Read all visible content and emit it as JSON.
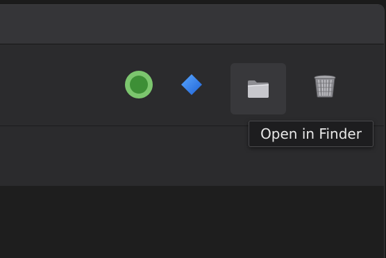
{
  "toolbar": {
    "status_icon": "status-green-dot-icon",
    "diamond_icon": "blue-diamond-icon",
    "finder_icon": "folder-icon",
    "trash_icon": "trash-icon"
  },
  "tooltip": {
    "text": "Open in Finder"
  },
  "colors": {
    "status_green_outer": "#7cc66e",
    "status_green_inner": "#3d8f36",
    "diamond_blue": "#2f80ed",
    "window_bg": "#2b2b2d",
    "titlebar_bg": "#353538",
    "content_bg": "#1e1e1e"
  }
}
